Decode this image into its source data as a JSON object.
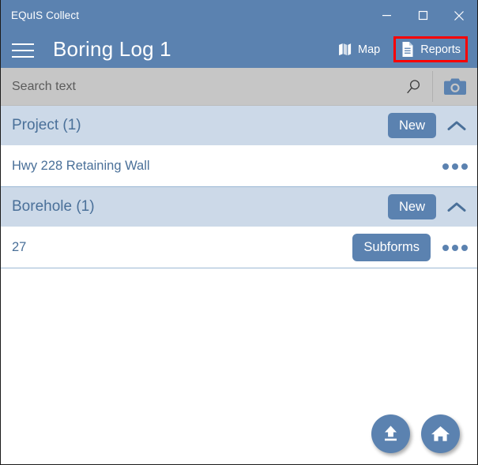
{
  "window": {
    "title": "EQuIS Collect",
    "controls": [
      {
        "name": "minimize",
        "label": "—"
      },
      {
        "name": "maximize",
        "label": "□"
      },
      {
        "name": "close",
        "label": "✕"
      }
    ]
  },
  "appbar": {
    "menu_icon": "hamburger-menu-icon",
    "title": "Boring Log 1",
    "actions": [
      {
        "id": "map",
        "label": "Map",
        "icon": "map-icon",
        "highlighted": false
      },
      {
        "id": "reports",
        "label": "Reports",
        "icon": "document-icon",
        "highlighted": true
      }
    ]
  },
  "search": {
    "placeholder": "Search text",
    "value": "",
    "icon": "search-icon",
    "camera_icon": "camera-icon"
  },
  "sections": [
    {
      "id": "project",
      "title": "Project (1)",
      "new_label": "New",
      "collapse_icon": "chevron-up-icon",
      "expanded": true,
      "rows": [
        {
          "label": "Hwy 228 Retaining Wall",
          "has_subforms": false,
          "subforms_label": "",
          "overflow_icon": "more-options-icon"
        }
      ]
    },
    {
      "id": "borehole",
      "title": "Borehole (1)",
      "new_label": "New",
      "collapse_icon": "chevron-up-icon",
      "expanded": true,
      "rows": [
        {
          "label": "27",
          "has_subforms": true,
          "subforms_label": "Subforms",
          "overflow_icon": "more-options-icon"
        }
      ]
    }
  ],
  "fabs": [
    {
      "id": "upload",
      "icon": "upload-icon",
      "label": "Upload"
    },
    {
      "id": "home",
      "icon": "home-icon",
      "label": "Home"
    }
  ],
  "colors": {
    "app_blue": "#5b82b0",
    "section_blue": "#ccd9e8",
    "text_blue": "#4a7099",
    "search_gray": "#c6c6c6",
    "highlight_red": "#fe0000"
  }
}
